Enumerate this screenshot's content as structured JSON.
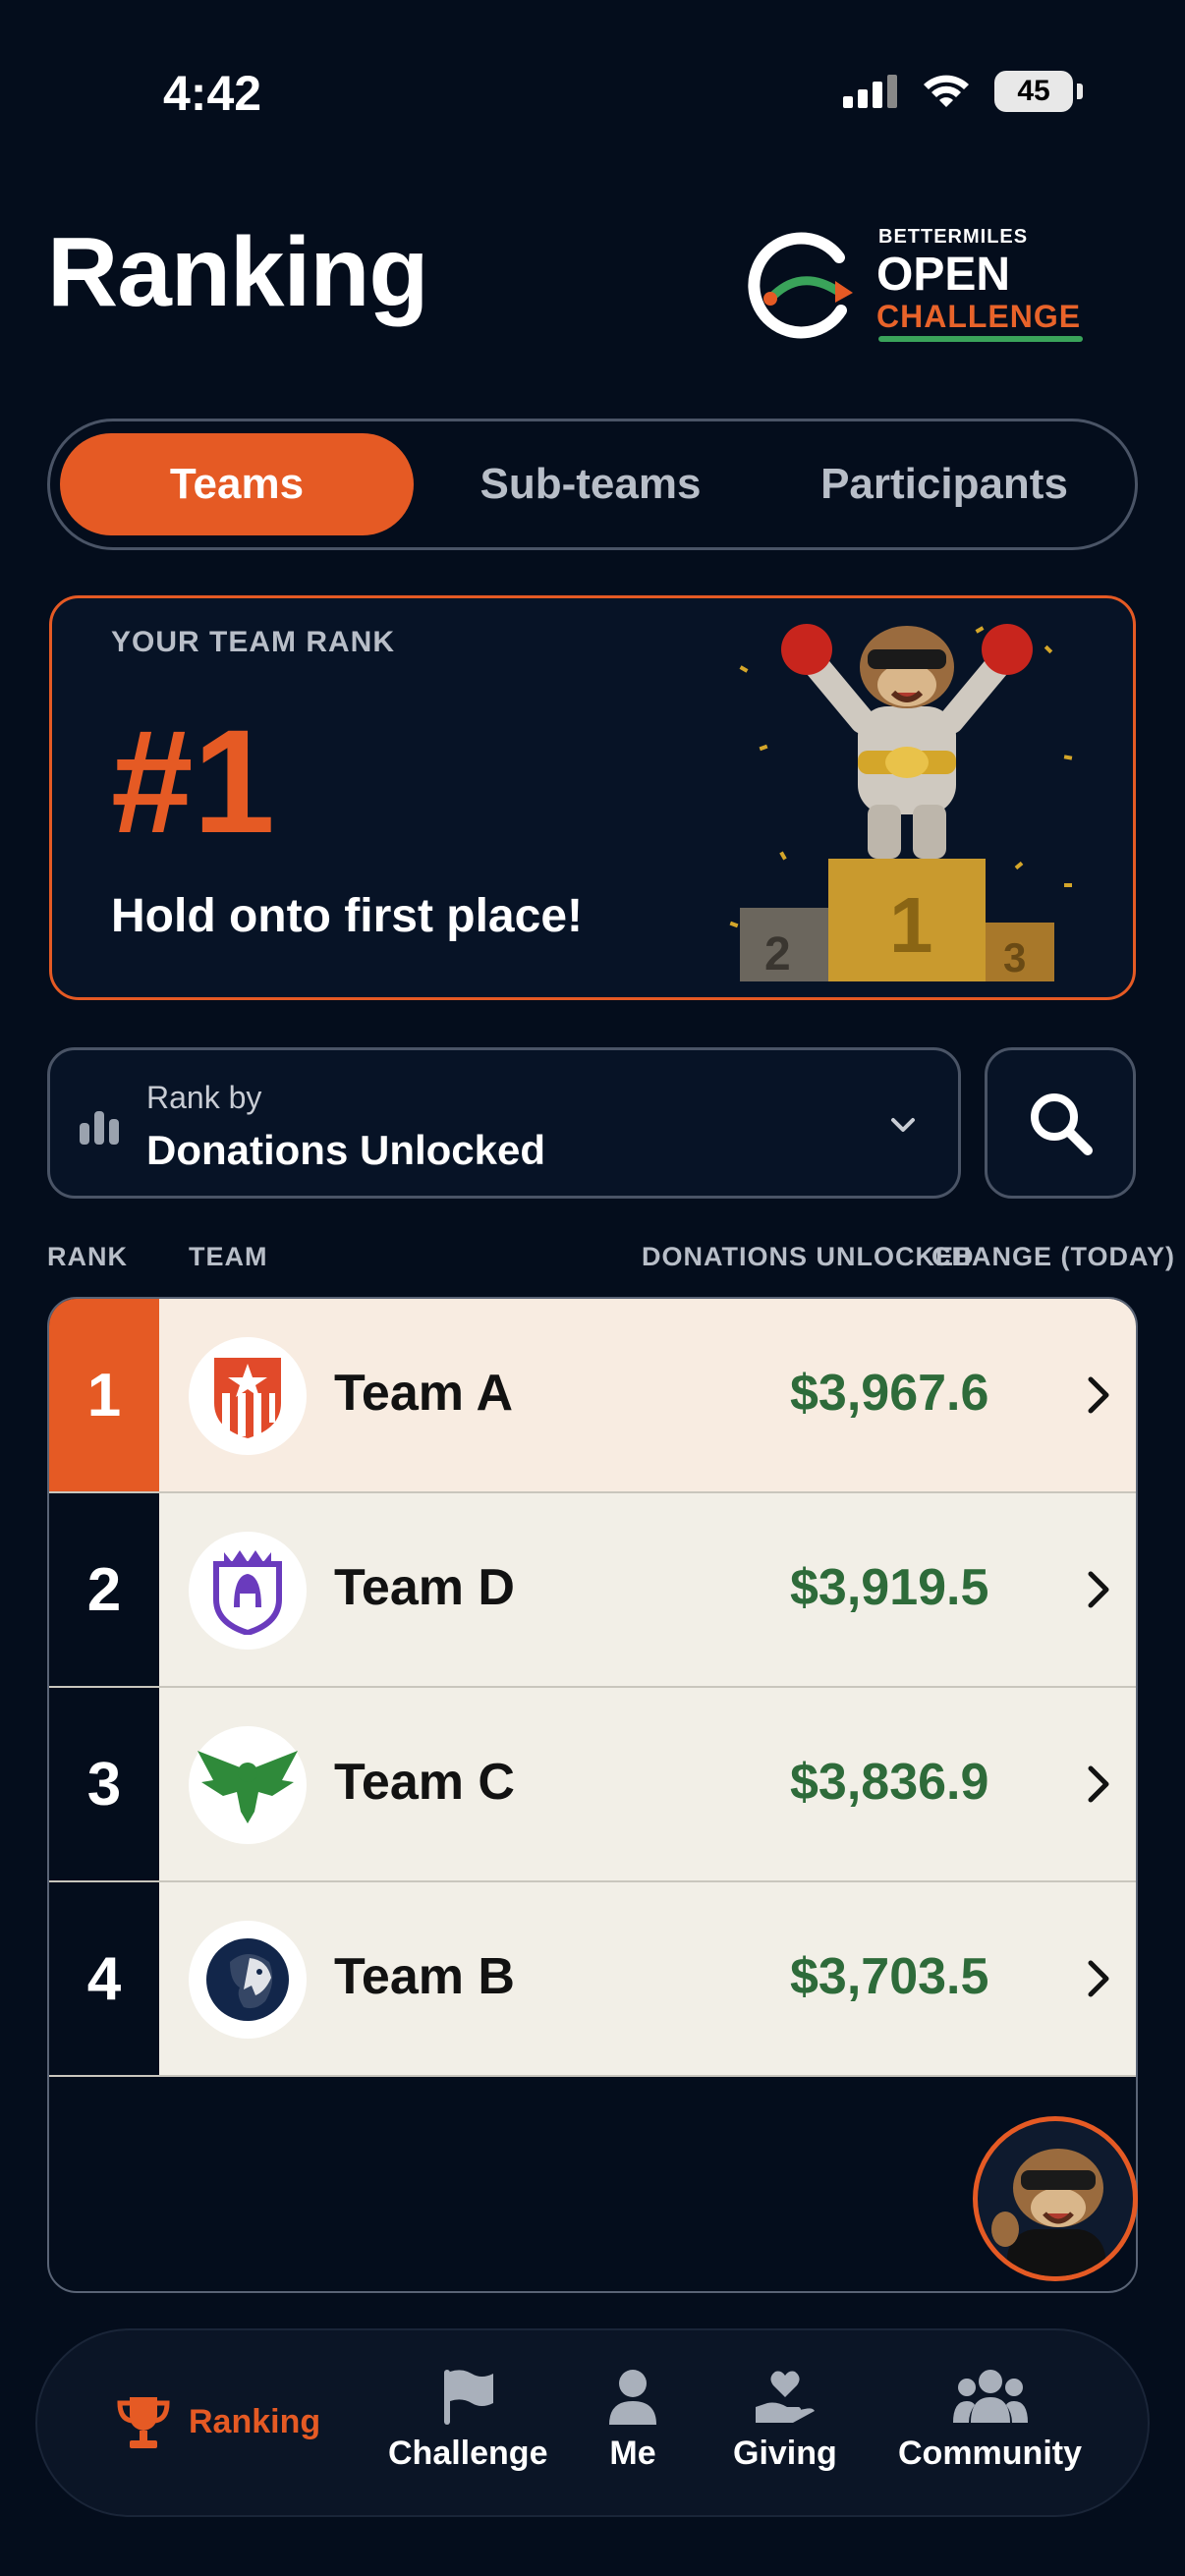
{
  "status": {
    "time": "4:42",
    "battery": "45"
  },
  "header": {
    "title": "Ranking",
    "logo": {
      "top": "BETTERMILES",
      "main": "OPEN",
      "sub": "CHALLENGE"
    }
  },
  "tabs": [
    {
      "label": "Teams",
      "active": true
    },
    {
      "label": "Sub-teams",
      "active": false
    },
    {
      "label": "Participants",
      "active": false
    }
  ],
  "rank_card": {
    "label": "YOUR TEAM RANK",
    "value": "#1",
    "message": "Hold onto first place!"
  },
  "rank_by": {
    "label": "Rank by",
    "value": "Donations Unlocked"
  },
  "table": {
    "headers": [
      "RANK",
      "TEAM",
      "DONATIONS UNLOCKED",
      "CHANGE (TODAY)"
    ],
    "rows": [
      {
        "rank": "1",
        "team": "Team A",
        "amount": "$3,967.6",
        "logo": "shield-star-icon"
      },
      {
        "rank": "2",
        "team": "Team D",
        "amount": "$3,919.5",
        "logo": "spartan-helmet-icon"
      },
      {
        "rank": "3",
        "team": "Team C",
        "amount": "$3,836.9",
        "logo": "eagle-icon"
      },
      {
        "rank": "4",
        "team": "Team B",
        "amount": "$3,703.5",
        "logo": "lion-icon"
      }
    ]
  },
  "nav": {
    "items": [
      {
        "label": "Ranking",
        "icon": "trophy-icon",
        "active": true
      },
      {
        "label": "Challenge",
        "icon": "flag-icon"
      },
      {
        "label": "Me",
        "icon": "person-icon"
      },
      {
        "label": "Giving",
        "icon": "heart-hand-icon"
      },
      {
        "label": "Community",
        "icon": "group-icon"
      }
    ]
  },
  "colors": {
    "accent": "#e55a24",
    "background": "#040d1c",
    "amount": "#2e6b3a"
  }
}
